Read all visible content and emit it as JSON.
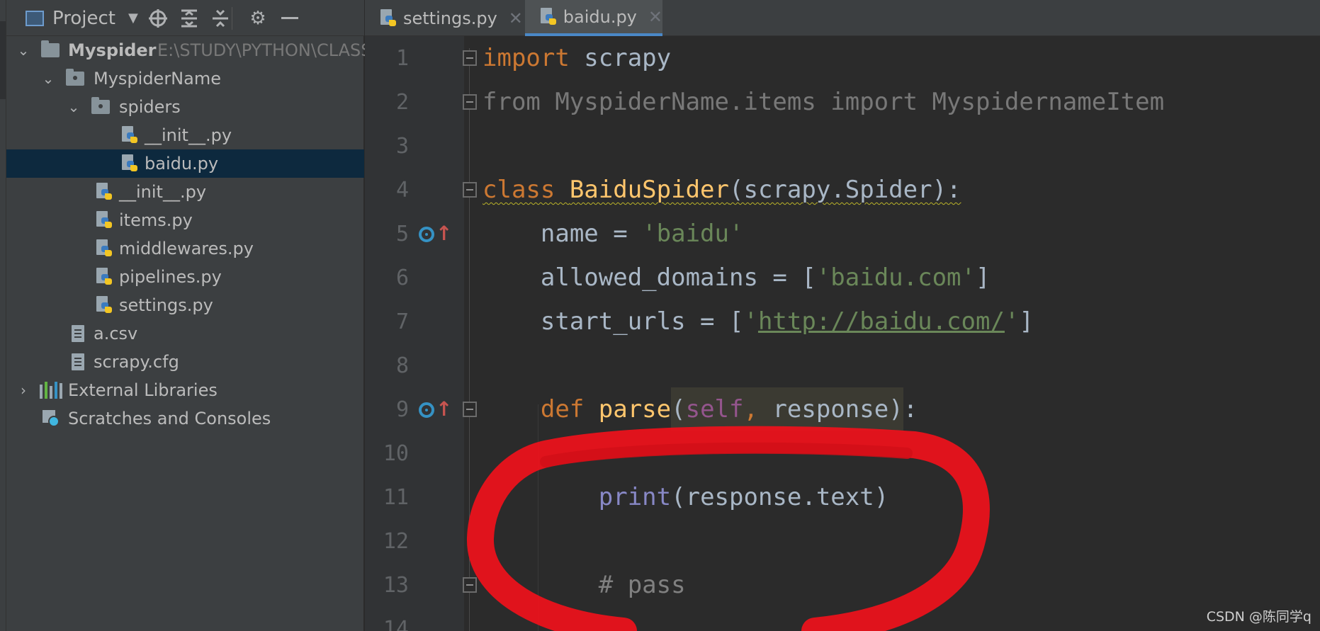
{
  "toolbar": {
    "title": "Project",
    "icons": [
      "project-view-icon",
      "chevron-down-icon",
      "locate-icon",
      "expand-all-icon",
      "collapse-all-icon",
      "gear-icon",
      "minimize-icon"
    ]
  },
  "tree": [
    {
      "label": "Myspider",
      "path": "E:\\STUDY\\PYTHON\\CLASS",
      "icon": "folder-icon",
      "depth": 0,
      "expanded": true,
      "bold": true
    },
    {
      "label": "MyspiderName",
      "icon": "package-icon",
      "depth": 1,
      "expanded": true
    },
    {
      "label": "spiders",
      "icon": "package-icon",
      "depth": 2,
      "expanded": true
    },
    {
      "label": "__init__.py",
      "icon": "python-file-icon",
      "depth": 3
    },
    {
      "label": "baidu.py",
      "icon": "python-file-icon",
      "depth": 3,
      "selected": true
    },
    {
      "label": "__init__.py",
      "icon": "python-file-icon",
      "depth": 2
    },
    {
      "label": "items.py",
      "icon": "python-file-icon",
      "depth": 2
    },
    {
      "label": "middlewares.py",
      "icon": "python-file-icon",
      "depth": 2
    },
    {
      "label": "pipelines.py",
      "icon": "python-file-icon",
      "depth": 2
    },
    {
      "label": "settings.py",
      "icon": "python-file-icon",
      "depth": 2
    },
    {
      "label": "a.csv",
      "icon": "text-file-icon",
      "depth": 1
    },
    {
      "label": "scrapy.cfg",
      "icon": "text-file-icon",
      "depth": 1
    },
    {
      "label": "External Libraries",
      "icon": "libraries-icon",
      "depth": 0,
      "expanded": false
    },
    {
      "label": "Scratches and Consoles",
      "icon": "scratches-icon",
      "depth": 0
    }
  ],
  "tabs": [
    {
      "label": "settings.py",
      "active": false
    },
    {
      "label": "baidu.py",
      "active": true
    }
  ],
  "editor": {
    "line_numbers": [
      "1",
      "2",
      "3",
      "4",
      "5",
      "6",
      "7",
      "8",
      "9",
      "10",
      "11",
      "12",
      "13",
      "14"
    ],
    "lines": [
      {
        "n": 1,
        "tokens": [
          [
            "kw",
            "import"
          ],
          [
            "",
            " scrapy"
          ]
        ]
      },
      {
        "n": 2,
        "tokens": [
          [
            "dim",
            "from MyspiderName.items import MyspidernameItem"
          ]
        ]
      },
      {
        "n": 3,
        "tokens": []
      },
      {
        "n": 4,
        "tokens": [
          [
            "kw squiggle",
            "class "
          ],
          [
            "cls squiggle",
            "BaiduSpider"
          ],
          [
            "squiggle",
            "(scrapy.Spider):"
          ]
        ]
      },
      {
        "n": 5,
        "tokens": [
          [
            "",
            "    name = "
          ],
          [
            "str",
            "'baidu'"
          ]
        ]
      },
      {
        "n": 6,
        "tokens": [
          [
            "",
            "    allowed_domains = ["
          ],
          [
            "str",
            "'baidu.com'"
          ],
          [
            "",
            "]"
          ]
        ]
      },
      {
        "n": 7,
        "tokens": [
          [
            "",
            "    start_urls = ["
          ],
          [
            "str",
            "'"
          ],
          [
            "url",
            "http://baidu.com/"
          ],
          [
            "str",
            "'"
          ],
          [
            "",
            "]"
          ]
        ]
      },
      {
        "n": 8,
        "tokens": []
      },
      {
        "n": 9,
        "tokens": [
          [
            "kw",
            "    def "
          ],
          [
            "fn",
            "parse"
          ],
          [
            "hl-open",
            "("
          ],
          [
            "self",
            "self"
          ],
          [
            "kw",
            ", "
          ],
          [
            "hl",
            "response)"
          ],
          [
            "",
            ":"
          ]
        ]
      },
      {
        "n": 10,
        "tokens": []
      },
      {
        "n": 11,
        "tokens": [
          [
            "",
            "        "
          ],
          [
            "builtin",
            "print"
          ],
          [
            "",
            "(response.text)"
          ]
        ]
      },
      {
        "n": 12,
        "tokens": []
      },
      {
        "n": 13,
        "tokens": [
          [
            "",
            "        "
          ],
          [
            "comment",
            "# pass"
          ]
        ]
      }
    ],
    "gutter_markers": [
      {
        "line": 5,
        "icon": "implements-override-icon"
      },
      {
        "line": 9,
        "icon": "implements-override-icon"
      }
    ]
  },
  "annotation": {
    "shape": "red-hand-drawn-ellipse",
    "color": "#e8131c",
    "encloses_lines": [
      10,
      11,
      12,
      13
    ]
  },
  "watermark": "CSDN @陈同学q"
}
